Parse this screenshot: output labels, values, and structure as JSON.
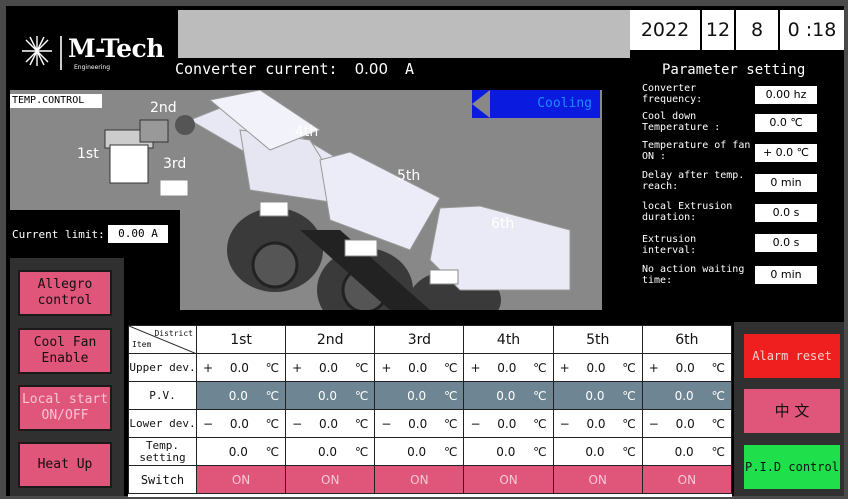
{
  "logo": {
    "name": "M-Tech",
    "sub": "Engineering"
  },
  "date": {
    "year": "2022",
    "month": "12",
    "day": "8",
    "time": "0 :18"
  },
  "converter": {
    "label": "Converter current:",
    "value": "0.00",
    "unit": "A"
  },
  "temp_control": {
    "label": "TEMP.CONTROL",
    "status": "Cooling",
    "stage_labels": [
      "1st",
      "2nd",
      "3rd",
      "4th",
      "5th",
      "6th"
    ],
    "current_limit_label": "Current limit:",
    "current_limit_value": "0.00 A"
  },
  "parameters": {
    "title": "Parameter setting",
    "items": [
      {
        "label": "Converter frequency:",
        "value": "0.00 hz"
      },
      {
        "label": "Cool down Temperature :",
        "value": "0.0 ℃"
      },
      {
        "label": "Temperature of fan ON :",
        "value": "+ 0.0 ℃"
      },
      {
        "label": "Delay after temp. reach:",
        "value": "0 min"
      },
      {
        "label": "local Extrusion duration:",
        "value": "0.0 s"
      },
      {
        "label": "Extrusion interval:",
        "value": "0.0 s"
      },
      {
        "label": "No action waiting time:",
        "value": "0 min"
      }
    ]
  },
  "left_buttons": [
    {
      "label": "Allegro control",
      "enabled": true
    },
    {
      "label": "Cool Fan Enable",
      "enabled": true
    },
    {
      "label": "Local start ON/OFF",
      "enabled": false
    },
    {
      "label": "Heat Up",
      "enabled": true
    }
  ],
  "table": {
    "corner_top": "District",
    "corner_bottom": "Item",
    "columns": [
      "1st",
      "2nd",
      "3rd",
      "4th",
      "5th",
      "6th"
    ],
    "unit": "℃",
    "rows": [
      {
        "label": "Upper dev.",
        "sign": "+",
        "values": [
          "0.0",
          "0.0",
          "0.0",
          "0.0",
          "0.0",
          "0.0"
        ]
      },
      {
        "label": "P.V.",
        "sign": "",
        "values": [
          "0.0",
          "0.0",
          "0.0",
          "0.0",
          "0.0",
          "0.0"
        ]
      },
      {
        "label": "Lower dev.",
        "sign": "−",
        "values": [
          "0.0",
          "0.0",
          "0.0",
          "0.0",
          "0.0",
          "0.0"
        ]
      },
      {
        "label": "Temp. setting",
        "sign": "",
        "values": [
          "0.0",
          "0.0",
          "0.0",
          "0.0",
          "0.0",
          "0.0"
        ]
      }
    ],
    "switch_label": "Switch",
    "switch_values": [
      "ON",
      "ON",
      "ON",
      "ON",
      "ON",
      "ON"
    ]
  },
  "right_buttons": {
    "alarm_reset": "Alarm reset",
    "language": "中 文",
    "pid_control": "P.I.D control"
  },
  "colors": {
    "pink": "#e0557a",
    "pv_blue": "#6e8694",
    "cooling_blue": "#0a1adf",
    "alarm_red": "#ef1f1f",
    "pid_green": "#1fe04a"
  }
}
